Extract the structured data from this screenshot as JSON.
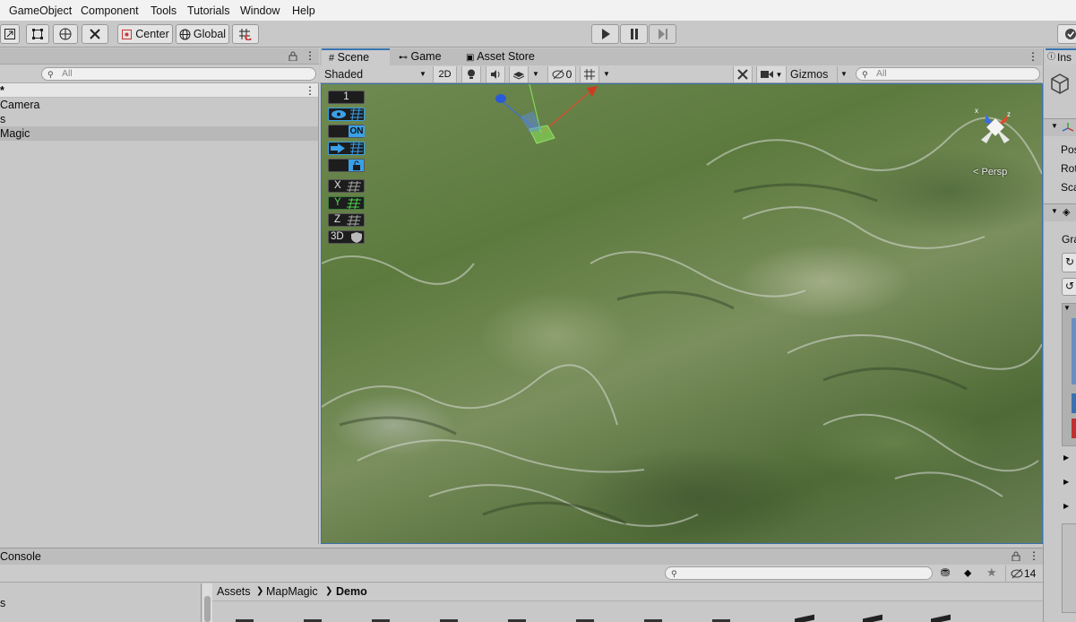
{
  "menu": [
    "GameObject",
    "Component",
    "Tools",
    "Tutorials",
    "Window",
    "Help"
  ],
  "toolbar": {
    "pivot_label": "Center",
    "space_label": "Global"
  },
  "hierarchy": {
    "search_placeholder": "All",
    "scene_name": "*",
    "items": [
      {
        "label": "Camera",
        "selected": false
      },
      {
        "label": "s",
        "selected": false
      },
      {
        "label": "Magic",
        "selected": true
      }
    ]
  },
  "scene_tabs": [
    {
      "label": "Scene",
      "active": true,
      "icon": "grid-icon"
    },
    {
      "label": "Game",
      "active": false,
      "icon": "gamepad-icon"
    },
    {
      "label": "Asset Store",
      "active": false,
      "icon": "bag-icon"
    }
  ],
  "scene_bar": {
    "shading_mode": "Shaded",
    "mode_2d": "2D",
    "hidden_count": "0",
    "gizmos_label": "Gizmos",
    "search_placeholder": "All"
  },
  "scene_overlay": {
    "buttons": [
      {
        "name": "number-button",
        "text": "1"
      },
      {
        "name": "visibility-button",
        "text": ""
      },
      {
        "name": "on-toggle",
        "text": "ON"
      },
      {
        "name": "arrow-button",
        "text": ""
      },
      {
        "name": "lock-button",
        "text": ""
      },
      {
        "name": "x-axis-button",
        "text": "X"
      },
      {
        "name": "y-axis-button",
        "text": "Y"
      },
      {
        "name": "z-axis-button",
        "text": "Z"
      },
      {
        "name": "3d-button",
        "text": "3D"
      }
    ],
    "persp_label": "< Persp"
  },
  "inspector": {
    "tab_label": "Ins",
    "rows": [
      "Pos",
      "Rot",
      "Sca",
      "Gra"
    ]
  },
  "bottom": {
    "tab_label": "Console",
    "hidden_count": "14",
    "left_item": "s",
    "breadcrumb": [
      "Assets",
      "MapMagic",
      "Demo"
    ]
  },
  "colors": {
    "accent": "#3a72b0",
    "selection": "#b8b8b8"
  }
}
